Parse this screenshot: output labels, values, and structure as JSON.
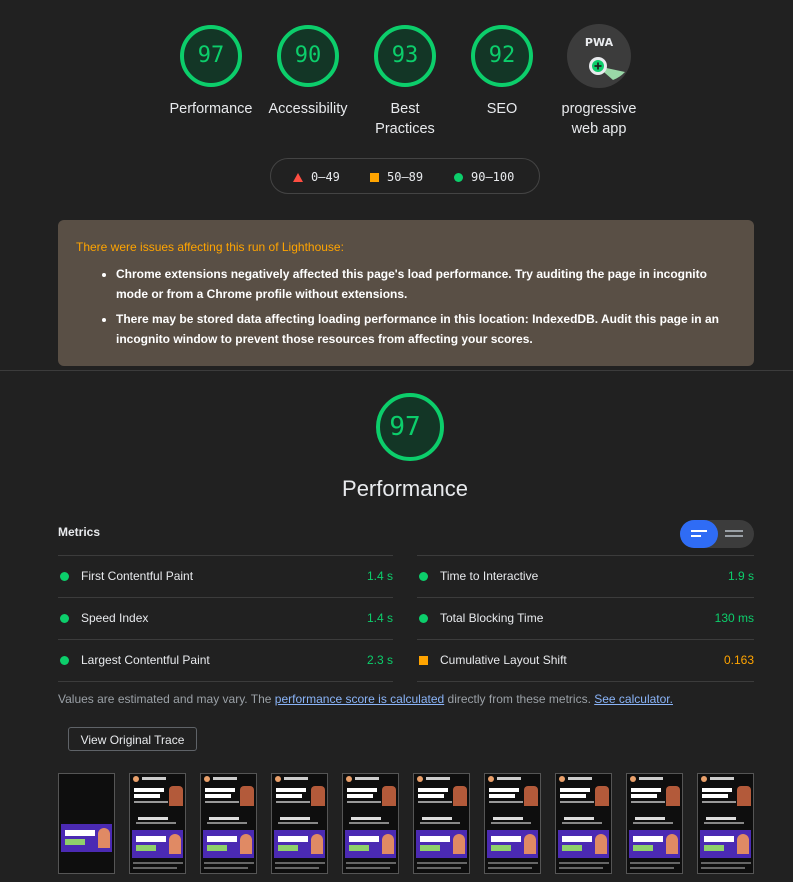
{
  "gauges": [
    {
      "score": "97",
      "label": "Performance"
    },
    {
      "score": "90",
      "label": "Accessibility"
    },
    {
      "score": "93",
      "label": "Best Practices"
    },
    {
      "score": "92",
      "label": "SEO"
    }
  ],
  "pwa": {
    "badge": "PWA",
    "label": "progressive web app"
  },
  "legend": {
    "fail": "0–49",
    "average": "50–89",
    "pass": "90–100"
  },
  "warning": {
    "title": "There were issues affecting this run of Lighthouse:",
    "items": [
      "Chrome extensions negatively affected this page's load performance. Try auditing the page in incognito mode or from a Chrome profile without extensions.",
      "There may be stored data affecting loading performance in this location: IndexedDB. Audit this page in an incognito window to prevent those resources from affecting your scores."
    ]
  },
  "performance": {
    "score": "97",
    "title": "Performance"
  },
  "metrics": {
    "heading": "Metrics",
    "left": [
      {
        "name": "First Contentful Paint",
        "value": "1.4 s",
        "status": "pass"
      },
      {
        "name": "Speed Index",
        "value": "1.4 s",
        "status": "pass"
      },
      {
        "name": "Largest Contentful Paint",
        "value": "2.3 s",
        "status": "pass"
      }
    ],
    "right": [
      {
        "name": "Time to Interactive",
        "value": "1.9 s",
        "status": "pass"
      },
      {
        "name": "Total Blocking Time",
        "value": "130 ms",
        "status": "pass"
      },
      {
        "name": "Cumulative Layout Shift",
        "value": "0.163",
        "status": "average"
      }
    ]
  },
  "note": {
    "prefix": "Values are estimated and may vary. The ",
    "link1": "performance score is calculated",
    "middle": " directly from these metrics. ",
    "link2": "See calculator."
  },
  "trace_button": "View Original Trace",
  "colors": {
    "pass": "#0cce6b",
    "average": "#ffa400",
    "fail": "#ff4e42",
    "accent": "#2f6cf5"
  }
}
